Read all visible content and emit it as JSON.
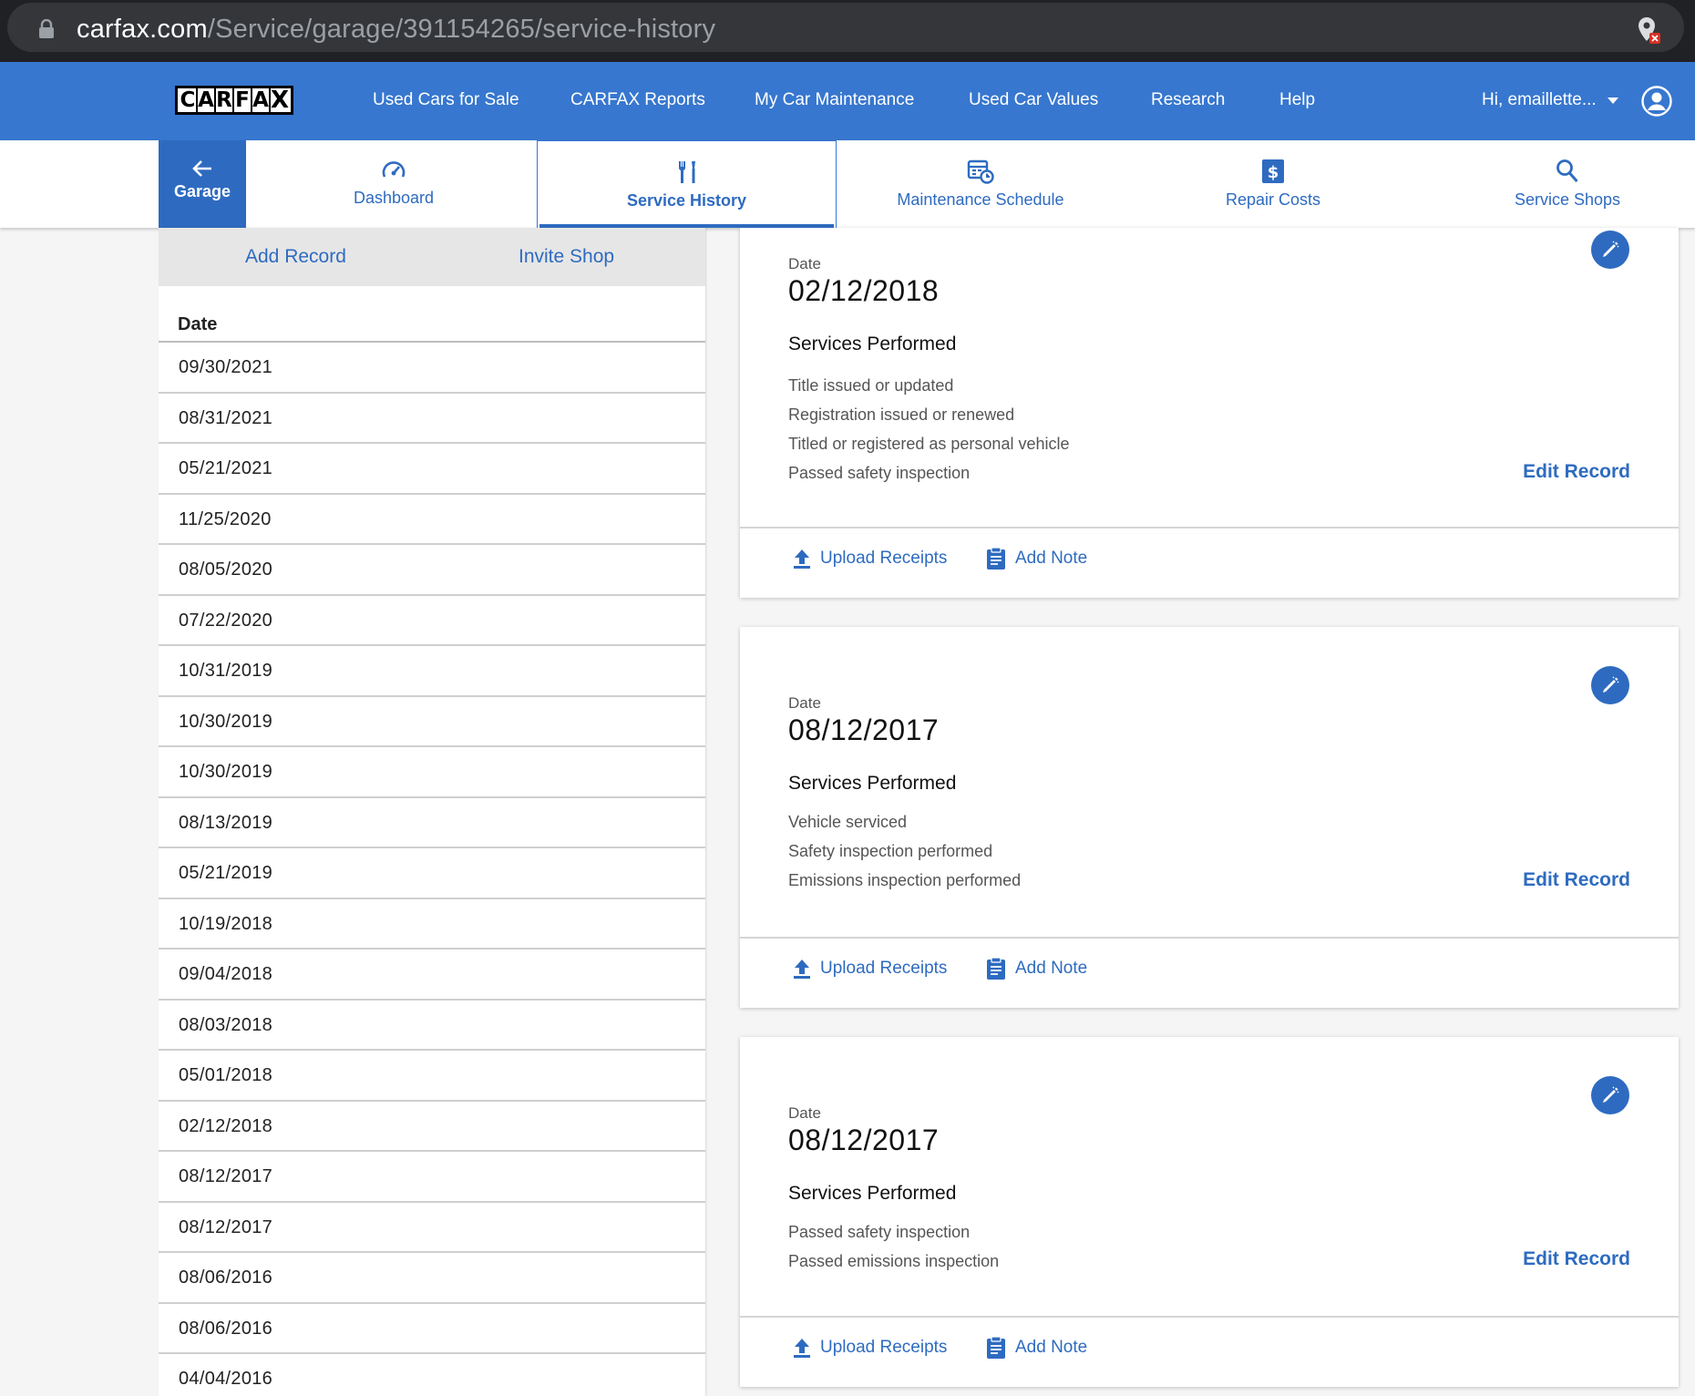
{
  "browser": {
    "url_host": "carfax.com",
    "url_path": "/Service/garage/391154265/service-history"
  },
  "header": {
    "logo_letters": [
      "C",
      "A",
      "R",
      "F",
      "A",
      "X"
    ],
    "nav": [
      "Used Cars for Sale",
      "CARFAX Reports",
      "My Car Maintenance",
      "Used Car Values",
      "Research",
      "Help"
    ],
    "user_greeting": "Hi, emaillette..."
  },
  "tabs": {
    "garage": "Garage",
    "items": [
      {
        "label": "Dashboard",
        "icon": "speedometer-icon"
      },
      {
        "label": "Service History",
        "icon": "wrench-screwdriver-icon",
        "active": true
      },
      {
        "label": "Maintenance Schedule",
        "icon": "calendar-clock-icon"
      },
      {
        "label": "Repair Costs",
        "icon": "dollar-icon"
      },
      {
        "label": "Service Shops",
        "icon": "search-icon"
      }
    ]
  },
  "sidebar": {
    "add_record": "Add Record",
    "invite_shop": "Invite Shop",
    "date_header": "Date",
    "dates": [
      "09/30/2021",
      "08/31/2021",
      "05/21/2021",
      "11/25/2020",
      "08/05/2020",
      "07/22/2020",
      "10/31/2019",
      "10/30/2019",
      "10/30/2019",
      "08/13/2019",
      "05/21/2019",
      "10/19/2018",
      "09/04/2018",
      "08/03/2018",
      "05/01/2018",
      "02/12/2018",
      "08/12/2017",
      "08/12/2017",
      "08/06/2016",
      "08/06/2016",
      "04/04/2016"
    ]
  },
  "records": [
    {
      "date_label": "Date",
      "date": "02/12/2018",
      "services_heading": "Services Performed",
      "services": [
        "Title issued or updated",
        "Registration issued or renewed",
        "Titled or registered as personal vehicle",
        "Passed safety inspection"
      ],
      "edit": "Edit Record",
      "upload": "Upload Receipts",
      "note": "Add Note"
    },
    {
      "date_label": "Date",
      "date": "08/12/2017",
      "services_heading": "Services Performed",
      "services": [
        "Vehicle serviced",
        "Safety inspection performed",
        "Emissions inspection performed"
      ],
      "edit": "Edit Record",
      "upload": "Upload Receipts",
      "note": "Add Note"
    },
    {
      "date_label": "Date",
      "date": "08/12/2017",
      "services_heading": "Services Performed",
      "services": [
        "Passed safety inspection",
        "Passed emissions inspection"
      ],
      "edit": "Edit Record",
      "upload": "Upload Receipts",
      "note": "Add Note"
    }
  ],
  "colors": {
    "brand_blue": "#3777cf",
    "link_blue": "#2e6bc0",
    "browser_dark": "#202124"
  }
}
